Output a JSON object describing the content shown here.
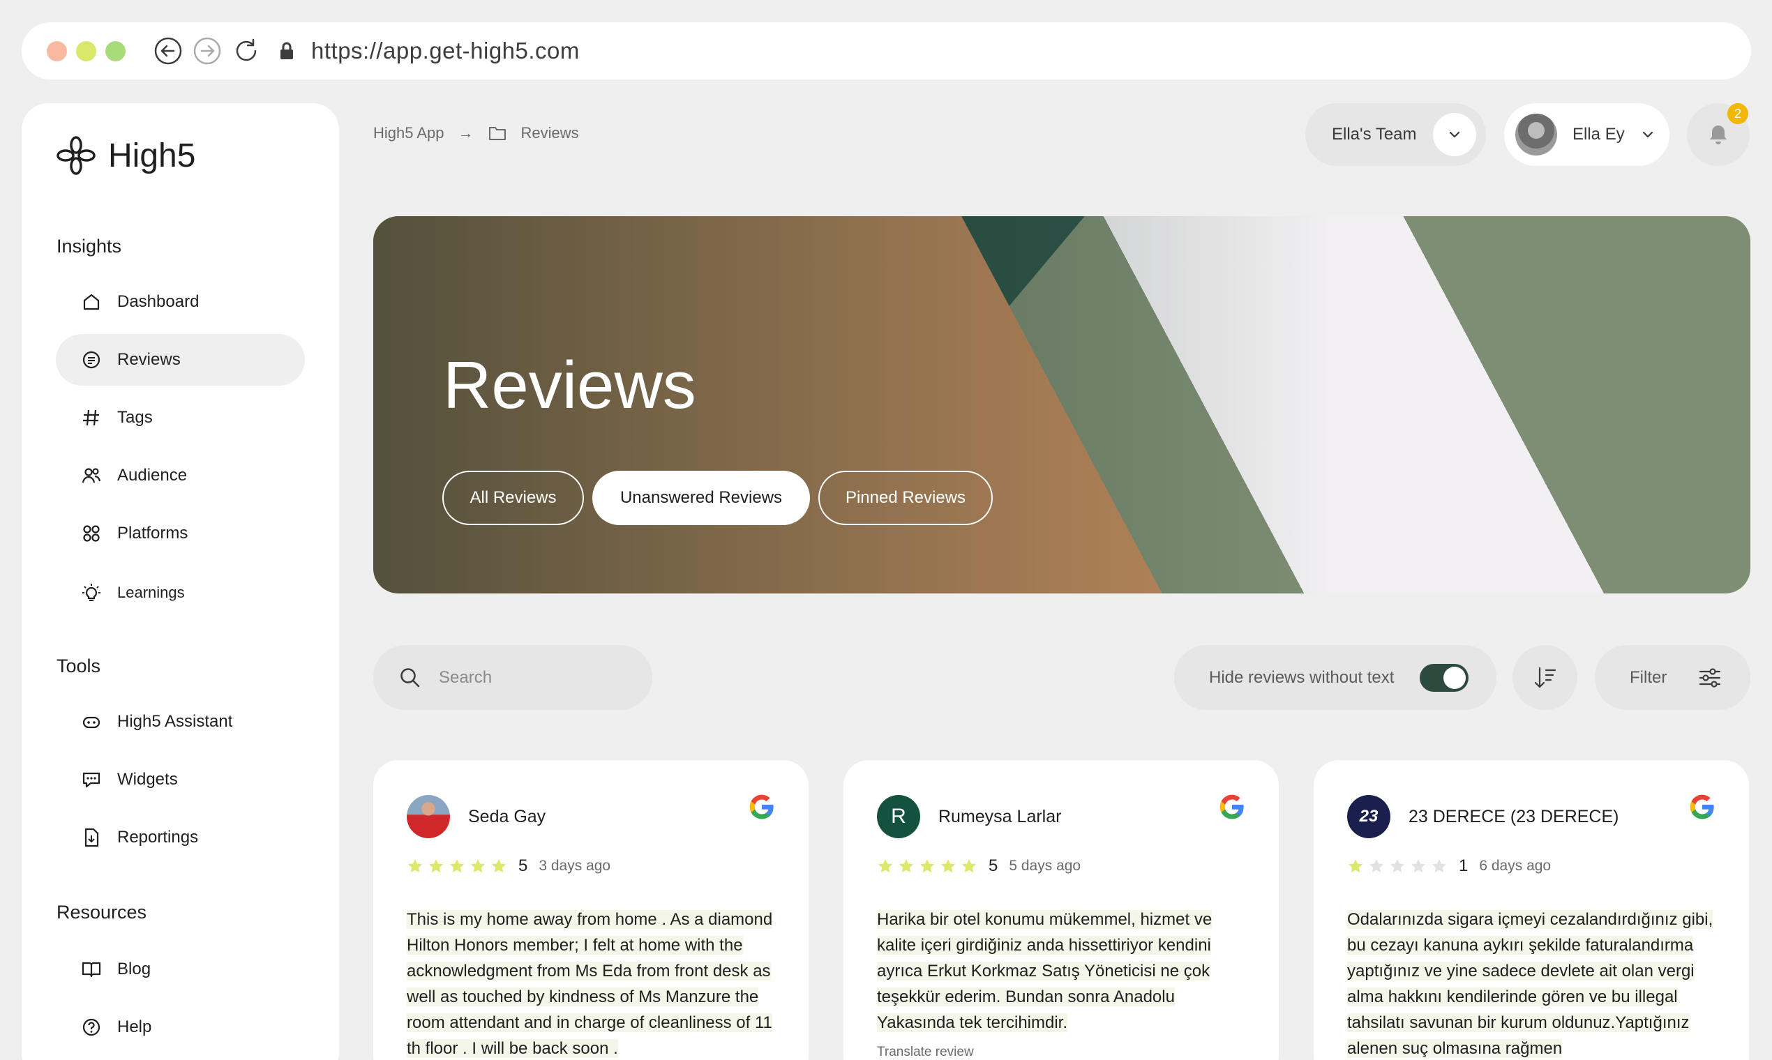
{
  "browser": {
    "url": "https://app.get-high5.com",
    "dot_colors": [
      "#f7b9a0",
      "#d9e86a",
      "#a8dc7a"
    ]
  },
  "sidebar": {
    "logo_text": "High5",
    "insights_title": "Insights",
    "insights": [
      {
        "label": "Dashboard",
        "icon": "home-icon"
      },
      {
        "label": "Reviews",
        "icon": "reviews-icon",
        "active": true
      },
      {
        "label": "Tags",
        "icon": "hashtag-icon"
      },
      {
        "label": "Audience",
        "icon": "audience-icon"
      },
      {
        "label": "Platforms",
        "icon": "platforms-icon"
      },
      {
        "label": "Learnings",
        "icon": "lightbulb-icon"
      }
    ],
    "tools_title": "Tools",
    "tools": [
      {
        "label": "High5 Assistant",
        "icon": "assistant-icon"
      },
      {
        "label": "Widgets",
        "icon": "widgets-icon"
      },
      {
        "label": "Reportings",
        "icon": "report-icon"
      }
    ],
    "resources_title": "Resources",
    "resources": [
      {
        "label": "Blog",
        "icon": "book-icon"
      },
      {
        "label": "Help",
        "icon": "help-icon"
      }
    ]
  },
  "header": {
    "breadcrumb_root": "High5 App",
    "breadcrumb_arrow": "→",
    "breadcrumb_current": "Reviews",
    "team": "Ella's Team",
    "user": "Ella Ey",
    "notification_count": "2"
  },
  "hero": {
    "title": "Reviews",
    "tabs": [
      {
        "label": "All Reviews",
        "active": false
      },
      {
        "label": "Unanswered Reviews",
        "active": true
      },
      {
        "label": "Pinned Reviews",
        "active": false
      }
    ]
  },
  "toolbar": {
    "search_placeholder": "Search",
    "hide_label": "Hide reviews without text",
    "hide_toggle_on": true,
    "filter_label": "Filter"
  },
  "colors": {
    "star_filled": "#dce86a",
    "star_empty": "#e2e2e2",
    "toggle_on": "#2e4a3e",
    "badge": "#f2b705"
  },
  "reviews": [
    {
      "name": "Seda Gay",
      "avatar_initial": "",
      "rating": 5,
      "stars_filled": 5,
      "date": "3 days ago",
      "platform": "google-icon",
      "text": "This is my home away from home . As a diamond Hilton Honors member; I felt at home with the acknowledgment from Ms Eda from front desk as well as touched by kindness of Ms Manzure the room attendant and in charge of cleanliness of 11 th floor . I will be back soon .",
      "translate": ""
    },
    {
      "name": "Rumeysa Larlar",
      "avatar_initial": "R",
      "rating": 5,
      "stars_filled": 5,
      "date": "5 days ago",
      "platform": "google-icon",
      "text": "Harika bir otel konumu mükemmel, hizmet ve kalite içeri girdiğiniz anda hissettiriyor kendini ayrıca Erkut Korkmaz Satış Yöneticisi ne çok teşekkür ederim. Bundan sonra Anadolu Yakasında tek tercihimdir.",
      "translate": "Translate review"
    },
    {
      "name": "23 DERECE (23 DERECE)",
      "avatar_initial": "23",
      "rating": 1,
      "stars_filled": 1,
      "date": "6 days ago",
      "platform": "google-icon",
      "text": "Odalarınızda sigara içmeyi cezalandırdığınız gibi, bu cezayı kanuna aykırı şekilde faturalandırma yaptığınız ve yine sadece devlete ait olan vergi alma hakkını kendilerinde gören ve bu illegal tahsilatı savunan bir kurum oldunuz.Yaptığınız alenen suç olmasına rağmen",
      "translate": ""
    }
  ]
}
